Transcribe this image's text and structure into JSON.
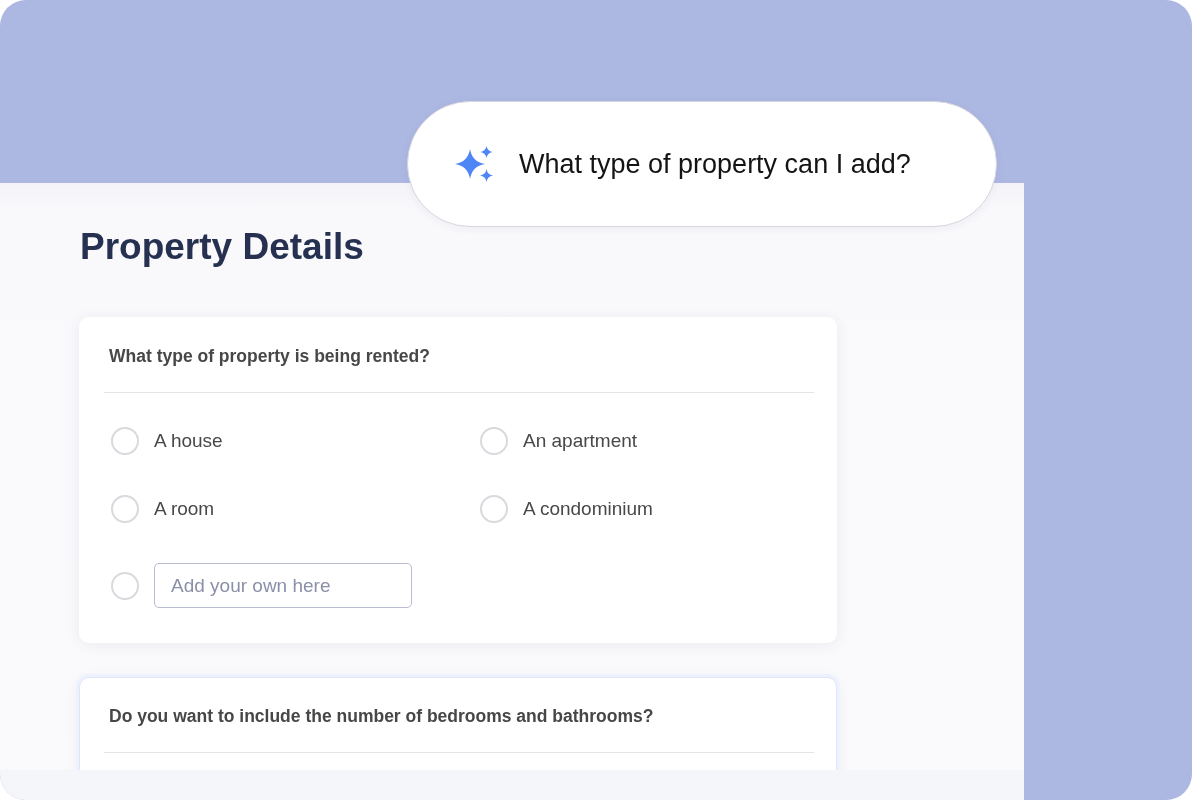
{
  "assistant_prompt": {
    "text": "What type of property can I add?"
  },
  "page": {
    "title": "Property Details"
  },
  "questions": [
    {
      "text": "What type of property is being rented?",
      "focused": false,
      "options": [
        {
          "kind": "choice",
          "label": "A house",
          "selected": false
        },
        {
          "kind": "choice",
          "label": "An apartment",
          "selected": false
        },
        {
          "kind": "choice",
          "label": "A room",
          "selected": false
        },
        {
          "kind": "choice",
          "label": "A condominium",
          "selected": false
        },
        {
          "kind": "custom",
          "placeholder": "Add your own here",
          "selected": false
        }
      ]
    },
    {
      "text": "Do you want to include the number of bedrooms and bathrooms?",
      "focused": true
    }
  ]
}
